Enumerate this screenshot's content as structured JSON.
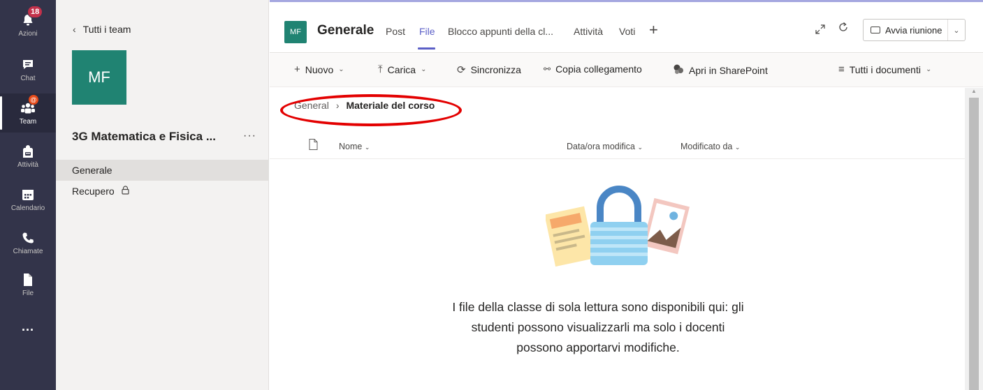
{
  "rail": {
    "items": [
      {
        "label": "Azioni",
        "icon": "bell-icon",
        "badge": "18"
      },
      {
        "label": "Chat",
        "icon": "chat-icon"
      },
      {
        "label": "Team",
        "icon": "team-icon",
        "active": true,
        "mention": "@"
      },
      {
        "label": "Attività",
        "icon": "backpack-icon"
      },
      {
        "label": "Calendario",
        "icon": "calendar-icon"
      },
      {
        "label": "Chiamate",
        "icon": "phone-icon"
      },
      {
        "label": "File",
        "icon": "file-icon"
      },
      {
        "label": "...",
        "icon": "more-icon"
      }
    ]
  },
  "sidebar": {
    "back_label": "Tutti i team",
    "avatar_initials": "MF",
    "team_name": "3G Matematica e Fisica ...",
    "more": "···",
    "channels": [
      {
        "label": "Generale",
        "selected": true
      },
      {
        "label": "Recupero",
        "locked": true
      }
    ]
  },
  "header": {
    "avatar_initials": "MF",
    "channel_title": "Generale",
    "tabs": [
      {
        "label": "Post"
      },
      {
        "label": "File",
        "active": true
      },
      {
        "label": "Blocco appunti della cl..."
      },
      {
        "label": "Attività"
      },
      {
        "label": "Voti"
      }
    ],
    "add_tab": "+",
    "meeting_button": "Avvia riunione"
  },
  "commands": {
    "new": "Nuovo",
    "upload": "Carica",
    "sync": "Sincronizza",
    "copy_link": "Copia collegamento",
    "open_sharepoint": "Apri in SharePoint",
    "view": "Tutti i documenti"
  },
  "breadcrumb": {
    "root": "General",
    "current": "Materiale del corso"
  },
  "columns": {
    "name": "Nome",
    "modified": "Data/ora modifica",
    "modified_by": "Modificato da"
  },
  "empty_state": {
    "message": "I file della classe di sola lettura sono disponibili qui: gli studenti possono visualizzarli ma solo i docenti possono apportarvi modifiche."
  },
  "colors": {
    "rail_bg": "#33344a",
    "accent": "#5b5fc7",
    "team_avatar": "#208372",
    "badge": "#c4314b",
    "annotation": "#e30000"
  }
}
